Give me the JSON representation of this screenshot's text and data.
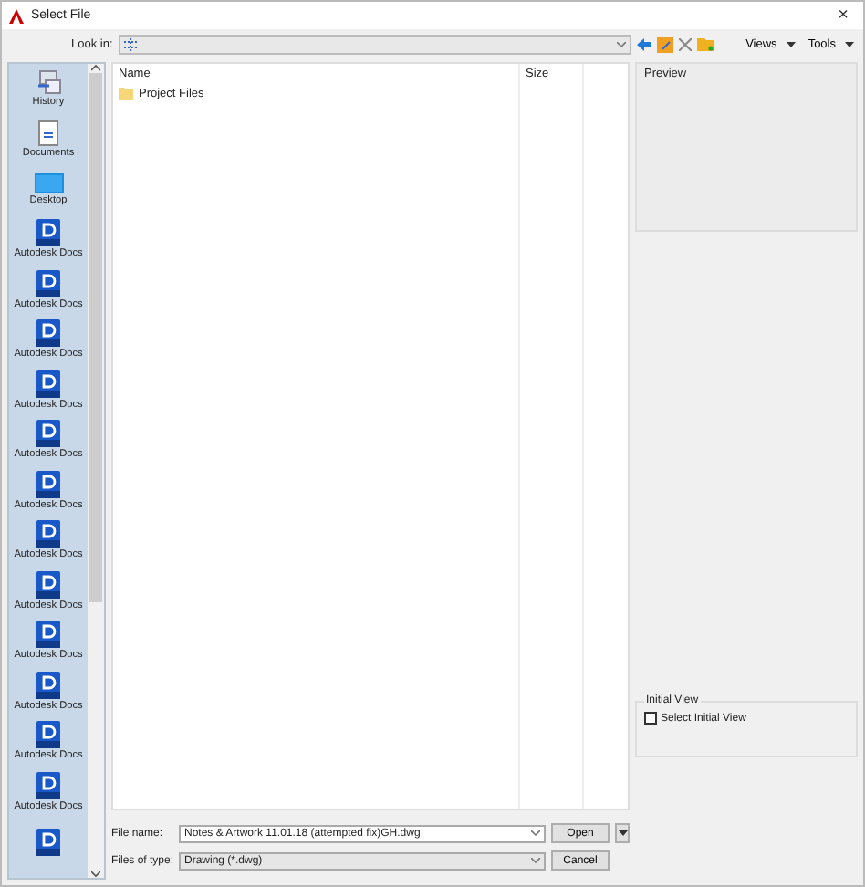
{
  "window": {
    "title": "Select File",
    "close": "×"
  },
  "look_in": {
    "label": "Look in:"
  },
  "toolbar": {
    "views": "Views",
    "tools": "Tools"
  },
  "sidebar": {
    "items": [
      {
        "kind": "history",
        "label": "History"
      },
      {
        "kind": "documents",
        "label": "Documents"
      },
      {
        "kind": "desktop",
        "label": "Desktop"
      },
      {
        "kind": "docs",
        "label": "Autodesk Docs"
      },
      {
        "kind": "docs",
        "label": "Autodesk Docs"
      },
      {
        "kind": "docs",
        "label": "Autodesk Docs"
      },
      {
        "kind": "docs",
        "label": "Autodesk Docs"
      },
      {
        "kind": "docs",
        "label": "Autodesk Docs"
      },
      {
        "kind": "docs",
        "label": "Autodesk Docs"
      },
      {
        "kind": "docs",
        "label": "Autodesk Docs"
      },
      {
        "kind": "docs",
        "label": "Autodesk Docs"
      },
      {
        "kind": "docs",
        "label": "Autodesk Docs"
      },
      {
        "kind": "docs",
        "label": "Autodesk Docs"
      },
      {
        "kind": "docs",
        "label": "Autodesk Docs"
      },
      {
        "kind": "docs",
        "label": "Autodesk Docs"
      },
      {
        "kind": "docs"
      }
    ]
  },
  "file_list": {
    "columns": [
      "Name",
      "Size"
    ],
    "rows": [
      {
        "kind": "folder",
        "name": "Project Files"
      }
    ]
  },
  "preview": {
    "label": "Preview"
  },
  "initial_view": {
    "title": "Initial View",
    "checkbox": {
      "label": "Select Initial View",
      "checked": false
    }
  },
  "file_name": {
    "label": "File name:",
    "value": "Notes & Artwork 11.01.18 (attempted fix)GH.dwg"
  },
  "files_of_type": {
    "label": "Files of type:",
    "value": "Drawing (*.dwg)"
  },
  "buttons": {
    "open": "Open",
    "cancel": "Cancel"
  }
}
